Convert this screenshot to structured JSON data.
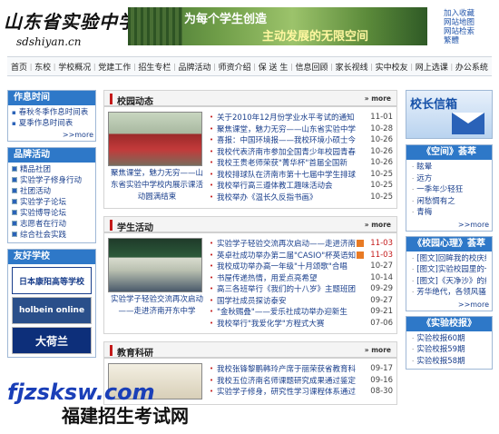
{
  "header": {
    "logo_cn": "山东省实验中学",
    "logo_url": "sdshiyan.cn",
    "banner_line1": "为每个学生创造",
    "banner_line2": "主动发展的无限空间",
    "links": [
      "加入收藏",
      "网站地图",
      "网站检索",
      "繁體"
    ]
  },
  "nav": [
    "首页",
    "东校",
    "学校概况",
    "党建工作",
    "招生专栏",
    "品牌活动",
    "师资介绍",
    "保 送 生",
    "信息回顾",
    "家长视线",
    "实中校友",
    "网上选课",
    "办公系统"
  ],
  "left": {
    "work_title": "作息时间",
    "work_items": [
      "春秋冬季作息时间表",
      "夏季作息时间表"
    ],
    "more": ">>more",
    "brand_title": "品牌活动",
    "brand_items": [
      "精品社团",
      "实验学子修身行动",
      "社团活动",
      "实验学子论坛",
      "实验博导论坛",
      "志愿者在行动",
      "综合社会实践"
    ],
    "friends_title": "友好学校",
    "friends": [
      "日本康阳高等学校",
      "holbein online",
      "大荷兰"
    ]
  },
  "center": {
    "news": {
      "title": "校园动态",
      "more": "more",
      "caption": "聚焦课堂，魅力无穷——山东省实验中学校内展示课活动圆满结束",
      "rows": [
        {
          "t": "关于2010年12月份学业水平考试的通知",
          "d": "11-01"
        },
        {
          "t": "聚焦课堂，魅力无穷——山东省实验中学",
          "d": "10-28"
        },
        {
          "t": "喜报：中国环境报——我校环境小硕士今",
          "d": "10-26"
        },
        {
          "t": "我校代表济南市参加全国青少年校园青春",
          "d": "10-26"
        },
        {
          "t": "我校王贵老师荣获\"菁华杯\"首届全国新",
          "d": "10-26"
        },
        {
          "t": "我校排球队在济南市第十七届中学生排球",
          "d": "10-25"
        },
        {
          "t": "我校举行高三遵体教工趣味活动会",
          "d": "10-25"
        },
        {
          "t": "我校举办《温长久反指书画》",
          "d": "10-25"
        }
      ]
    },
    "students": {
      "title": "学生活动",
      "more": "more",
      "caption": "实验学子轻验交流再次启动——走进济南开东中学",
      "rows": [
        {
          "t": "实验学子轻验交流再次启动——走进济南",
          "d": "11-03",
          "red": true,
          "new": true
        },
        {
          "t": "英卓社成功举办第二届\"CASIO\"杯英语知",
          "d": "11-03",
          "red": true,
          "new": true
        },
        {
          "t": "我校成功举办高一年级\"十月颂歌\"合唱",
          "d": "10-27"
        },
        {
          "t": "书屋传递热情，用爱点亮希望",
          "d": "10-14"
        },
        {
          "t": "高三各班举行《我们的十八岁》主题班团",
          "d": "09-29"
        },
        {
          "t": "国学社成员探访泰安",
          "d": "09-27"
        },
        {
          "t": "\"金秋赐叠\"——爱乐社成功举办迎新生",
          "d": "09-21"
        },
        {
          "t": "我校举行\"我爱化学\"方程式大赛",
          "d": "07-06"
        }
      ]
    },
    "research": {
      "title": "教育科研",
      "more": "more",
      "rows": [
        {
          "t": "我校张锋黎鹏韩玲产席于丽荣获省教育科",
          "d": "09-17"
        },
        {
          "t": "我校五位济南名师课题研究成果通过鉴定",
          "d": "09-16"
        },
        {
          "t": "实验学子修身，研究性学习课程体系通过",
          "d": "08-30"
        }
      ]
    }
  },
  "right": {
    "mailbox": "校长信箱",
    "space_title": "《空间》荟萃",
    "space_items": [
      "眩晕",
      "远方",
      "一季年少轻狂",
      "闲愁惆有之",
      "青梅"
    ],
    "psych_title": "《校园心理》荟萃",
    "psych_items": [
      "[图文]回眸我的校庆经历",
      "[图文]实验校园里的一个阿姨",
      "[图文]《天净沙》的约格",
      "芳华绝代，各领风骚与你同行"
    ],
    "report_title": "《实验校报》",
    "report_items": [
      "实验校报60期",
      "实验校报59期",
      "实验校报58期"
    ],
    "more": ">>more"
  },
  "watermark": {
    "line1": "fjzsksw.com",
    "line2": "福建招生考试网"
  }
}
